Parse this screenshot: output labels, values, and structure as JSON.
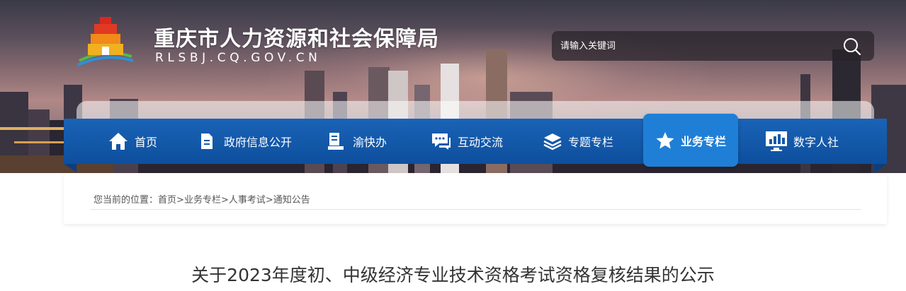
{
  "header": {
    "site_title": "重庆市人力资源和社会保障局",
    "site_domain": "RLSBJ.CQ.GOV.CN",
    "logo_icon": "tiered-gate-emblem-icon"
  },
  "search": {
    "placeholder": "请输入关键词",
    "button_icon": "search-icon"
  },
  "nav": {
    "items": [
      {
        "label": "首页",
        "icon": "home-icon"
      },
      {
        "label": "政府信息公开",
        "icon": "document-icon"
      },
      {
        "label": "渝快办",
        "icon": "form-icon"
      },
      {
        "label": "互动交流",
        "icon": "chat-icon"
      },
      {
        "label": "专题专栏",
        "icon": "layers-icon"
      },
      {
        "label": "业务专栏",
        "icon": "star-icon",
        "active": true
      },
      {
        "label": "数字人社",
        "icon": "monitor-chart-icon"
      }
    ],
    "active_color": "#1f7fd6",
    "bar_color": "#1559a8"
  },
  "breadcrumb": {
    "prefix": "您当前的位置：",
    "items": [
      "首页",
      "业务专栏",
      "人事考试",
      "通知公告"
    ],
    "separator": ">"
  },
  "article": {
    "title": "关于2023年度初、中级经济专业技术资格考试资格复核结果的公示"
  }
}
